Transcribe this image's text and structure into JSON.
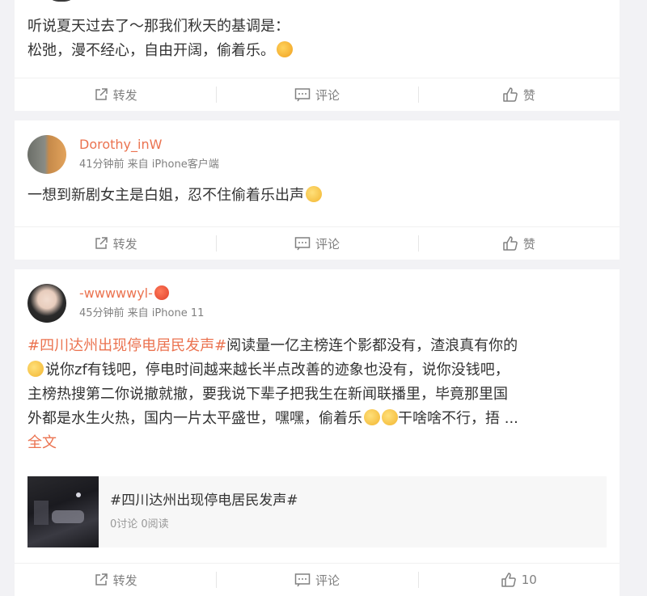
{
  "posts": [
    {
      "lines": [
        "听说夏天过去了～那我们秋天的基调是：",
        "松弛，漫不经心，自由开阔，偷着乐。"
      ],
      "actions": {
        "repost": "转发",
        "comment": "评论",
        "like": "赞"
      }
    },
    {
      "author": "Dorothy_inW",
      "meta": "41分钟前 来自 iPhone客户端",
      "text": "一想到新剧女主是白姐，忍不住偷着乐出声",
      "actions": {
        "repost": "转发",
        "comment": "评论",
        "like": "赞"
      }
    },
    {
      "author": "-wwwwwyl-",
      "meta": "45分钟前 来自 iPhone 11",
      "topic": "#四川达州出现停电居民发声#",
      "line1_rest": "阅读量一亿主榜连个影都没有，渣浪真有你的",
      "line2": "说你zf有钱吧，停电时间越来越长半点改善的迹象也没有，说你没钱吧，",
      "line3": "主榜热搜第二你说撤就撤，要我说下辈子把我生在新闻联播里，毕竟那里国",
      "line4a": "外都是水生火热，国内一片太平盛世，嘿嘿，偷着乐",
      "line4b": "干啥啥不行，捂 ...",
      "full_text": "全文",
      "topic_card": {
        "title": "#四川达州出现停电居民发声#",
        "stats": "0讨论 0阅读"
      },
      "actions": {
        "repost": "转发",
        "comment": "评论",
        "like": "10"
      }
    }
  ],
  "colors": {
    "accent": "#eb7350",
    "muted": "#808080",
    "background": "#f2f2f5"
  }
}
